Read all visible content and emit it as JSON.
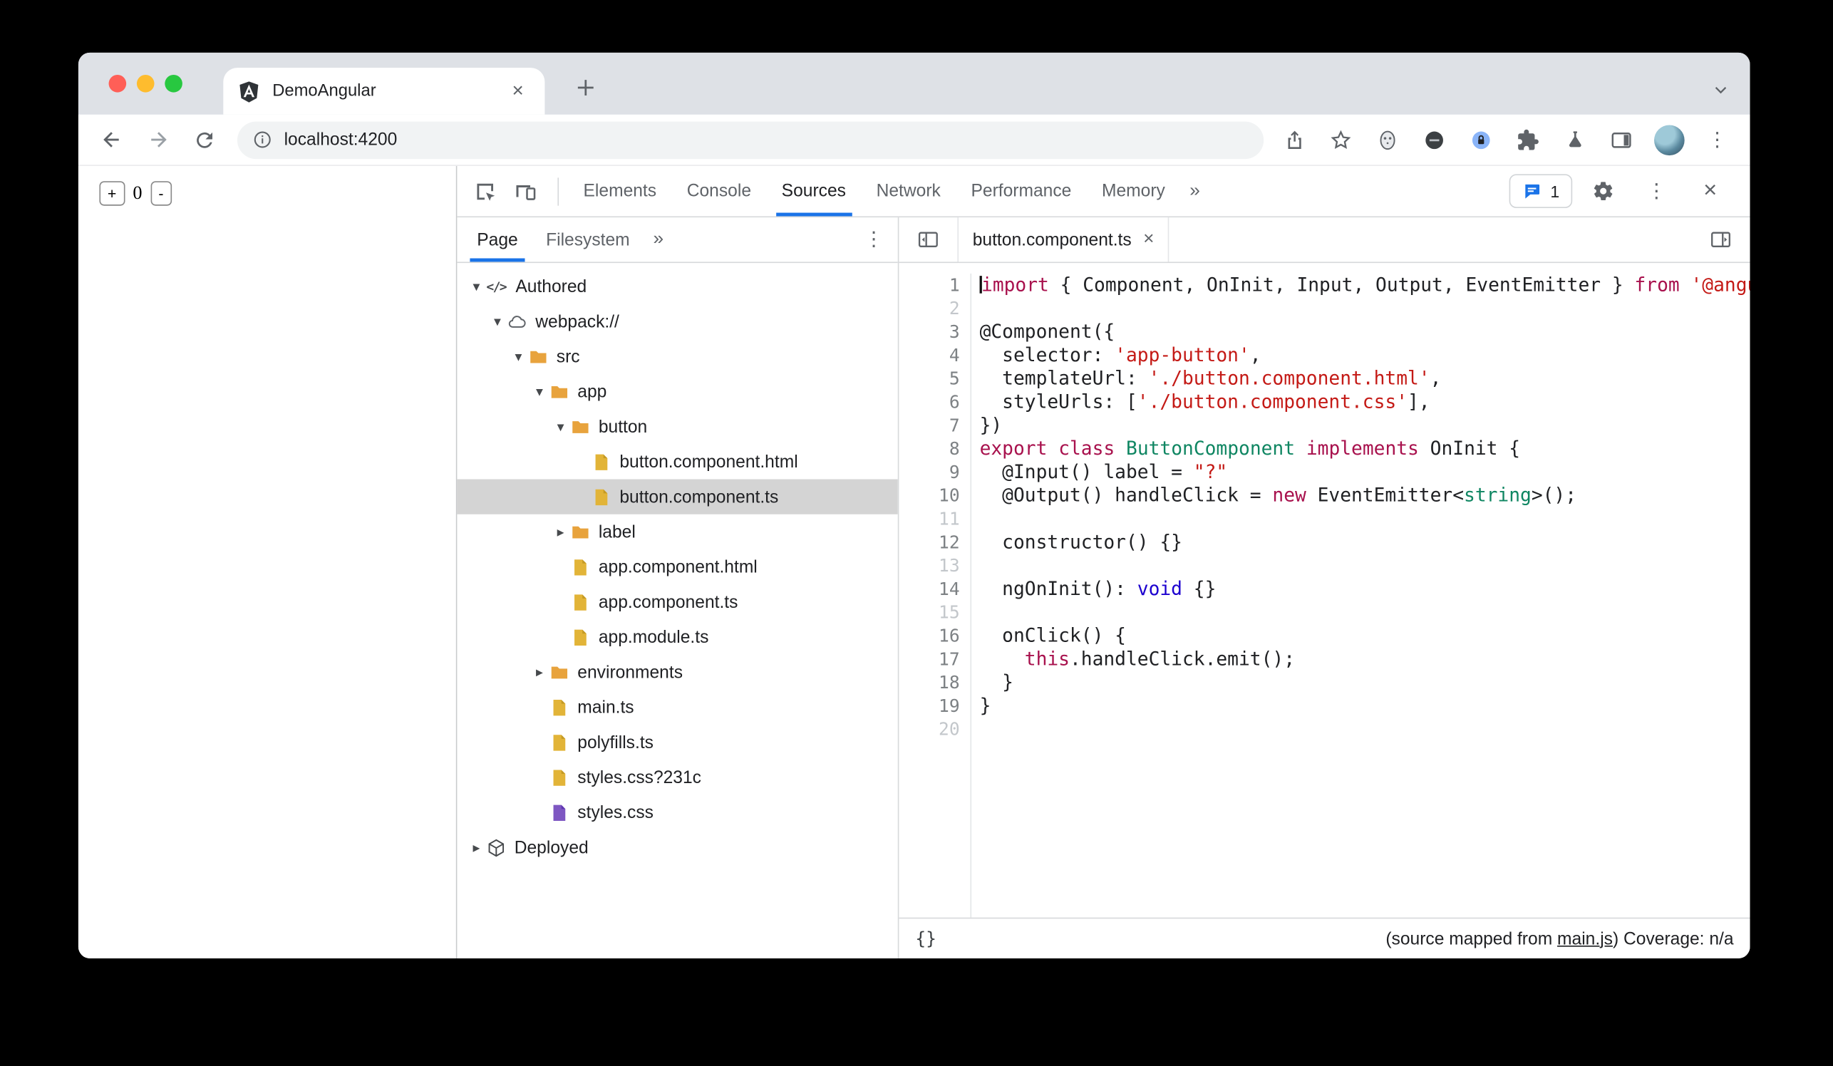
{
  "window": {
    "tab_title": "DemoAngular",
    "url": "localhost:4200",
    "new_tab_glyph": "+",
    "tab_close_glyph": "×"
  },
  "page_app": {
    "increment": "+",
    "count": "0",
    "decrement": "-"
  },
  "devtools": {
    "panel_tabs": [
      "Elements",
      "Console",
      "Sources",
      "Network",
      "Performance",
      "Memory"
    ],
    "selected_panel_tab": "Sources",
    "more_tabs": "»",
    "issues_count": "1",
    "close_glyph": "×",
    "colors": {
      "accent": "#1a73e8",
      "keyword": "#a8114d",
      "string": "#c41a16",
      "type": "#0f8662",
      "atom": "#1c00cf",
      "folder": "#e8a33d"
    },
    "navigator": {
      "tabs": [
        "Page",
        "Filesystem"
      ],
      "selected_tab": "Page",
      "more_tabs": "»",
      "tree": [
        {
          "label": "Authored",
          "depth": 0,
          "expand": "open",
          "icon": "source-code"
        },
        {
          "label": "webpack://",
          "depth": 1,
          "expand": "open",
          "icon": "cloud"
        },
        {
          "label": "src",
          "depth": 2,
          "expand": "open",
          "icon": "folder"
        },
        {
          "label": "app",
          "depth": 3,
          "expand": "open",
          "icon": "folder"
        },
        {
          "label": "button",
          "depth": 4,
          "expand": "open",
          "icon": "folder"
        },
        {
          "label": "button.component.html",
          "depth": 5,
          "expand": "none",
          "icon": "file",
          "file_color": "yellow"
        },
        {
          "label": "button.component.ts",
          "depth": 5,
          "expand": "none",
          "icon": "file",
          "file_color": "yellow",
          "selected": true
        },
        {
          "label": "label",
          "depth": 4,
          "expand": "closed",
          "icon": "folder"
        },
        {
          "label": "app.component.html",
          "depth": 4,
          "expand": "none",
          "icon": "file",
          "file_color": "yellow"
        },
        {
          "label": "app.component.ts",
          "depth": 4,
          "expand": "none",
          "icon": "file",
          "file_color": "yellow"
        },
        {
          "label": "app.module.ts",
          "depth": 4,
          "expand": "none",
          "icon": "file",
          "file_color": "yellow"
        },
        {
          "label": "environments",
          "depth": 3,
          "expand": "closed",
          "icon": "folder"
        },
        {
          "label": "main.ts",
          "depth": 3,
          "expand": "none",
          "icon": "file",
          "file_color": "yellow"
        },
        {
          "label": "polyfills.ts",
          "depth": 3,
          "expand": "none",
          "icon": "file",
          "file_color": "yellow"
        },
        {
          "label": "styles.css?231c",
          "depth": 3,
          "expand": "none",
          "icon": "file",
          "file_color": "yellow"
        },
        {
          "label": "styles.css",
          "depth": 3,
          "expand": "none",
          "icon": "file",
          "file_color": "purple"
        },
        {
          "label": "Deployed",
          "depth": 0,
          "expand": "closed",
          "icon": "deployed"
        }
      ]
    },
    "editor": {
      "file_tab": "button.component.ts",
      "close_glyph": "×",
      "code_lines": [
        {
          "n": "1",
          "tokens": [
            [
              "caret",
              ""
            ],
            [
              "k",
              "import"
            ],
            [
              "p",
              " { Component, OnInit, Input, Output, EventEmitter } "
            ],
            [
              "k",
              "from"
            ],
            [
              "p",
              " "
            ],
            [
              "s",
              "'@angular/core';"
            ]
          ]
        },
        {
          "n": "2",
          "tokens": []
        },
        {
          "n": "3",
          "tokens": [
            [
              "p",
              "@Component({"
            ]
          ]
        },
        {
          "n": "4",
          "tokens": [
            [
              "p",
              "  selector: "
            ],
            [
              "s",
              "'app-button'"
            ],
            [
              "p",
              ","
            ]
          ]
        },
        {
          "n": "5",
          "tokens": [
            [
              "p",
              "  templateUrl: "
            ],
            [
              "s",
              "'./button.component.html'"
            ],
            [
              "p",
              ","
            ]
          ]
        },
        {
          "n": "6",
          "tokens": [
            [
              "p",
              "  styleUrls: ["
            ],
            [
              "s",
              "'./button.component.css'"
            ],
            [
              "p",
              "],"
            ]
          ]
        },
        {
          "n": "7",
          "tokens": [
            [
              "p",
              "})"
            ]
          ]
        },
        {
          "n": "8",
          "tokens": [
            [
              "k",
              "export"
            ],
            [
              "p",
              " "
            ],
            [
              "k",
              "class"
            ],
            [
              "p",
              " "
            ],
            [
              "t",
              "ButtonComponent"
            ],
            [
              "p",
              " "
            ],
            [
              "k",
              "implements"
            ],
            [
              "p",
              " OnInit {"
            ]
          ]
        },
        {
          "n": "9",
          "tokens": [
            [
              "p",
              "  @Input() label = "
            ],
            [
              "s",
              "\"?\""
            ]
          ]
        },
        {
          "n": "10",
          "tokens": [
            [
              "p",
              "  @Output() handleClick = "
            ],
            [
              "k",
              "new"
            ],
            [
              "p",
              " EventEmitter<"
            ],
            [
              "t",
              "string"
            ],
            [
              "p",
              ">();"
            ]
          ]
        },
        {
          "n": "11",
          "tokens": []
        },
        {
          "n": "12",
          "tokens": [
            [
              "p",
              "  constructor() {}"
            ]
          ]
        },
        {
          "n": "13",
          "tokens": []
        },
        {
          "n": "14",
          "tokens": [
            [
              "p",
              "  ngOnInit(): "
            ],
            [
              "v",
              "void"
            ],
            [
              "p",
              " {}"
            ]
          ]
        },
        {
          "n": "15",
          "tokens": []
        },
        {
          "n": "16",
          "tokens": [
            [
              "p",
              "  onClick() {"
            ]
          ]
        },
        {
          "n": "17",
          "tokens": [
            [
              "p",
              "    "
            ],
            [
              "k",
              "this"
            ],
            [
              "p",
              ".handleClick.emit();"
            ]
          ]
        },
        {
          "n": "18",
          "tokens": [
            [
              "p",
              "  }"
            ]
          ]
        },
        {
          "n": "19",
          "tokens": [
            [
              "p",
              "}"
            ]
          ]
        },
        {
          "n": "20",
          "tokens": []
        }
      ],
      "status": {
        "format": "{}",
        "prefix": "(source mapped from ",
        "link": "main.js",
        "suffix": ") Coverage: n/a"
      }
    }
  }
}
